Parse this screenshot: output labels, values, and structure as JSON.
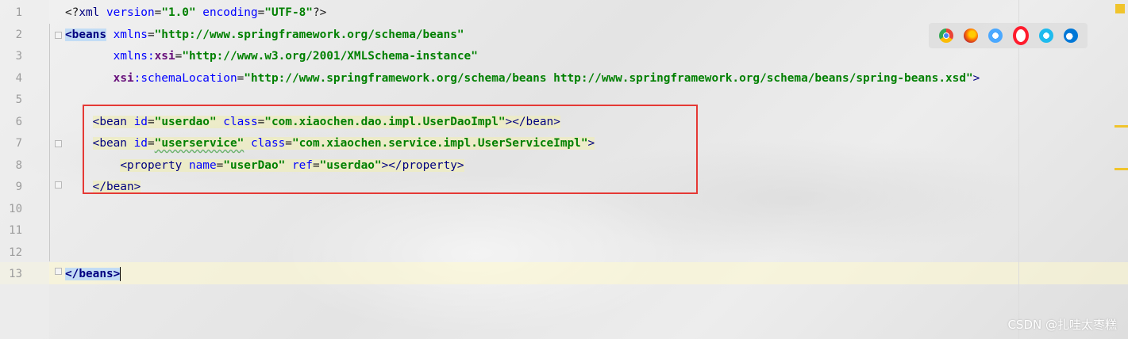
{
  "editor": {
    "line_numbers": [
      "1",
      "2",
      "3",
      "4",
      "5",
      "6",
      "7",
      "8",
      "9",
      "10",
      "11",
      "12",
      "13"
    ],
    "line1": {
      "open": "<?",
      "tag": "xml",
      "attr1": " version",
      "eq1": "=",
      "val1": "\"1.0\"",
      "attr2": " encoding",
      "eq2": "=",
      "val2": "\"UTF-8\"",
      "close": "?>"
    },
    "line2": {
      "open": "<beans",
      "attr": " xmlns",
      "eq": "=",
      "val": "\"http://www.springframework.org/schema/beans\""
    },
    "line3": {
      "indent": "       ",
      "attr_prefix": "xmlns:",
      "attr_ns": "xsi",
      "eq": "=",
      "val": "\"http://www.w3.org/2001/XMLSchema-instance\""
    },
    "line4": {
      "indent": "       ",
      "attr_ns": "xsi",
      "attr_rest": ":schemaLocation",
      "eq": "=",
      "val": "\"http://www.springframework.org/schema/beans http://www.springframework.org/schema/beans/spring-beans.xsd\"",
      "close": ">"
    },
    "line6": {
      "indent": "    ",
      "open": "<bean",
      "attr1": " id",
      "eq1": "=",
      "val1": "\"userdao\"",
      "attr2": " class",
      "eq2": "=",
      "val2": "\"com.xiaochen.dao.impl.UserDaoImpl\"",
      "close": "></bean>"
    },
    "line7": {
      "indent": "    ",
      "open": "<bean",
      "attr1": " id",
      "eq1": "=",
      "val1": "\"userservice\"",
      "attr2": " class",
      "eq2": "=",
      "val2": "\"com.xiaochen.service.impl.UserServiceImpl\"",
      "close": ">"
    },
    "line8": {
      "indent": "        ",
      "open": "<property",
      "attr1": " name",
      "eq1": "=",
      "val1": "\"userDao\"",
      "attr2": " ref",
      "eq2": "=",
      "val2": "\"userdao\"",
      "close": "></property>"
    },
    "line9": {
      "indent": "    ",
      "close": "</bean>"
    },
    "line13": {
      "close": "</beans>"
    }
  },
  "browser_icons": [
    "chrome-icon",
    "firefox-icon",
    "safari-icon",
    "opera-icon",
    "ie-icon",
    "edge-icon"
  ],
  "watermark": "CSDN @扎哇太枣糕",
  "colors": {
    "tag": "#000080",
    "attr": "#0000ff",
    "value": "#008000",
    "namespace": "#660e7a",
    "highlight_box": "#e53935",
    "current_line": "#fffacd"
  }
}
